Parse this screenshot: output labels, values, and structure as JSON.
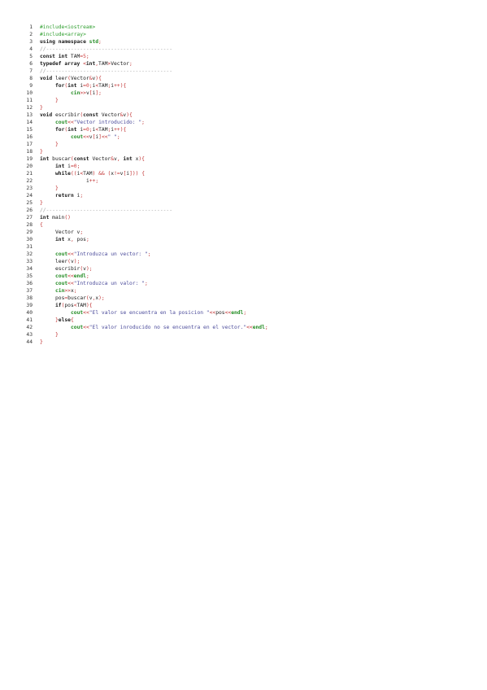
{
  "document": {
    "lines": [
      {
        "n": "1",
        "indent": 0,
        "segs": [
          [
            "pre",
            "#include<iostream>"
          ]
        ]
      },
      {
        "n": "2",
        "indent": 0,
        "segs": [
          [
            "pre",
            "#include<array>"
          ]
        ]
      },
      {
        "n": "3",
        "indent": 0,
        "segs": [
          [
            "kw",
            "using namespace "
          ],
          [
            "io",
            "std"
          ],
          [
            "op",
            ";"
          ]
        ]
      },
      {
        "n": "4",
        "indent": 0,
        "segs": [
          [
            "cm",
            "//-----------------------------------------"
          ]
        ]
      },
      {
        "n": "5",
        "indent": 0,
        "segs": [
          [
            "kw",
            "const int "
          ],
          [
            "id",
            "TAM"
          ],
          [
            "op",
            "="
          ],
          [
            "num",
            "5"
          ],
          [
            "op",
            ";"
          ]
        ]
      },
      {
        "n": "6",
        "indent": 0,
        "segs": [
          [
            "kw",
            "typedef array "
          ],
          [
            "op",
            "<"
          ],
          [
            "kw",
            "int"
          ],
          [
            "op",
            ","
          ],
          [
            "id",
            "TAM"
          ],
          [
            "op",
            ">"
          ],
          [
            "id",
            "Vector"
          ],
          [
            "op",
            ";"
          ]
        ]
      },
      {
        "n": "7",
        "indent": 0,
        "segs": [
          [
            "cm",
            "//-----------------------------------------"
          ]
        ]
      },
      {
        "n": "8",
        "indent": 0,
        "segs": [
          [
            "kw",
            "void "
          ],
          [
            "id",
            "leer"
          ],
          [
            "op",
            "("
          ],
          [
            "id",
            "Vector"
          ],
          [
            "op",
            "&"
          ],
          [
            "id",
            "v"
          ],
          [
            "op",
            ")"
          ],
          [
            "op",
            "{"
          ]
        ]
      },
      {
        "n": "9",
        "indent": 1,
        "segs": [
          [
            "kw",
            "for"
          ],
          [
            "op",
            "("
          ],
          [
            "kw",
            "int "
          ],
          [
            "id",
            "i"
          ],
          [
            "op",
            "="
          ],
          [
            "num",
            "0"
          ],
          [
            "op",
            ";"
          ],
          [
            "id",
            "i"
          ],
          [
            "op",
            "<"
          ],
          [
            "id",
            "TAM"
          ],
          [
            "op",
            ";"
          ],
          [
            "id",
            "i"
          ],
          [
            "op",
            "++"
          ],
          [
            "op",
            ")"
          ],
          [
            "op",
            "{"
          ]
        ]
      },
      {
        "n": "10",
        "indent": 2,
        "segs": [
          [
            "io",
            "cin"
          ],
          [
            "op",
            ">>"
          ],
          [
            "id",
            "v"
          ],
          [
            "op",
            "["
          ],
          [
            "id",
            "i"
          ],
          [
            "op",
            "]"
          ],
          [
            "op",
            ";"
          ]
        ]
      },
      {
        "n": "11",
        "indent": 1,
        "segs": [
          [
            "op",
            "}"
          ]
        ]
      },
      {
        "n": "12",
        "indent": 0,
        "segs": [
          [
            "op",
            "}"
          ]
        ]
      },
      {
        "n": "13",
        "indent": 0,
        "segs": [
          [
            "kw",
            "void "
          ],
          [
            "id",
            "escribir"
          ],
          [
            "op",
            "("
          ],
          [
            "kw",
            "const "
          ],
          [
            "id",
            "Vector"
          ],
          [
            "op",
            "&"
          ],
          [
            "id",
            "v"
          ],
          [
            "op",
            ")"
          ],
          [
            "op",
            "{"
          ]
        ]
      },
      {
        "n": "14",
        "indent": 1,
        "segs": [
          [
            "io",
            "cout"
          ],
          [
            "op",
            "<<"
          ],
          [
            "str",
            "\"Vector introducido: \""
          ],
          [
            "op",
            ";"
          ]
        ]
      },
      {
        "n": "15",
        "indent": 1,
        "segs": [
          [
            "kw",
            "for"
          ],
          [
            "op",
            "("
          ],
          [
            "kw",
            "int "
          ],
          [
            "id",
            "i"
          ],
          [
            "op",
            "="
          ],
          [
            "num",
            "0"
          ],
          [
            "op",
            ";"
          ],
          [
            "id",
            "i"
          ],
          [
            "op",
            "<"
          ],
          [
            "id",
            "TAM"
          ],
          [
            "op",
            ";"
          ],
          [
            "id",
            "i"
          ],
          [
            "op",
            "++"
          ],
          [
            "op",
            ")"
          ],
          [
            "op",
            "{"
          ]
        ]
      },
      {
        "n": "16",
        "indent": 2,
        "segs": [
          [
            "io",
            "cout"
          ],
          [
            "op",
            "<<"
          ],
          [
            "id",
            "v"
          ],
          [
            "op",
            "["
          ],
          [
            "id",
            "i"
          ],
          [
            "op",
            "]"
          ],
          [
            "op",
            "<<"
          ],
          [
            "str",
            "\" \""
          ],
          [
            "op",
            ";"
          ]
        ]
      },
      {
        "n": "17",
        "indent": 1,
        "segs": [
          [
            "op",
            "}"
          ]
        ]
      },
      {
        "n": "18",
        "indent": 0,
        "segs": [
          [
            "op",
            "}"
          ]
        ]
      },
      {
        "n": "19",
        "indent": 0,
        "segs": [
          [
            "kw",
            "int "
          ],
          [
            "id",
            "buscar"
          ],
          [
            "op",
            "("
          ],
          [
            "kw",
            "const "
          ],
          [
            "id",
            "Vector"
          ],
          [
            "op",
            "&"
          ],
          [
            "id",
            "v"
          ],
          [
            "op",
            ", "
          ],
          [
            "kw",
            "int "
          ],
          [
            "id",
            "x"
          ],
          [
            "op",
            ")"
          ],
          [
            "op",
            "{"
          ]
        ]
      },
      {
        "n": "20",
        "indent": 1,
        "segs": [
          [
            "kw",
            "int "
          ],
          [
            "id",
            "i"
          ],
          [
            "op",
            "="
          ],
          [
            "num",
            "0"
          ],
          [
            "op",
            ";"
          ]
        ]
      },
      {
        "n": "21",
        "indent": 1,
        "segs": [
          [
            "kw",
            "while"
          ],
          [
            "op",
            "(("
          ],
          [
            "id",
            "i"
          ],
          [
            "op",
            "<"
          ],
          [
            "id",
            "TAM"
          ],
          [
            "op",
            ") && ("
          ],
          [
            "id",
            "x"
          ],
          [
            "op",
            "!="
          ],
          [
            "id",
            "v"
          ],
          [
            "op",
            "["
          ],
          [
            "id",
            "i"
          ],
          [
            "op",
            "])) {"
          ]
        ]
      },
      {
        "n": "22",
        "indent": 3,
        "segs": [
          [
            "id",
            "i"
          ],
          [
            "op",
            "++;"
          ]
        ]
      },
      {
        "n": "23",
        "indent": 1,
        "segs": [
          [
            "op",
            "}"
          ]
        ]
      },
      {
        "n": "24",
        "indent": 1,
        "segs": [
          [
            "kw",
            "return "
          ],
          [
            "id",
            "i"
          ],
          [
            "op",
            ";"
          ]
        ]
      },
      {
        "n": "25",
        "indent": 0,
        "segs": [
          [
            "op",
            "}"
          ]
        ]
      },
      {
        "n": "26",
        "indent": 0,
        "segs": [
          [
            "cm",
            "//-----------------------------------------"
          ]
        ]
      },
      {
        "n": "27",
        "indent": 0,
        "segs": [
          [
            "kw",
            "int "
          ],
          [
            "id",
            "main"
          ],
          [
            "op",
            "()"
          ]
        ]
      },
      {
        "n": "28",
        "indent": 0,
        "segs": [
          [
            "op",
            "{"
          ]
        ]
      },
      {
        "n": "29",
        "indent": 1,
        "segs": [
          [
            "id",
            "Vector v"
          ],
          [
            "op",
            ";"
          ]
        ]
      },
      {
        "n": "30",
        "indent": 1,
        "segs": [
          [
            "kw",
            "int "
          ],
          [
            "id",
            "x"
          ],
          [
            "op",
            ", "
          ],
          [
            "id",
            "pos"
          ],
          [
            "op",
            ";"
          ]
        ]
      },
      {
        "n": "31",
        "indent": 0,
        "segs": []
      },
      {
        "n": "32",
        "indent": 1,
        "segs": [
          [
            "io",
            "cout"
          ],
          [
            "op",
            "<<"
          ],
          [
            "str",
            "\"Introduzca un vector: \""
          ],
          [
            "op",
            ";"
          ]
        ]
      },
      {
        "n": "33",
        "indent": 1,
        "segs": [
          [
            "id",
            "leer"
          ],
          [
            "op",
            "("
          ],
          [
            "id",
            "v"
          ],
          [
            "op",
            ");"
          ]
        ]
      },
      {
        "n": "34",
        "indent": 1,
        "segs": [
          [
            "id",
            "escribir"
          ],
          [
            "op",
            "("
          ],
          [
            "id",
            "v"
          ],
          [
            "op",
            ");"
          ]
        ]
      },
      {
        "n": "35",
        "indent": 1,
        "segs": [
          [
            "io",
            "cout"
          ],
          [
            "op",
            "<<"
          ],
          [
            "io",
            "endl"
          ],
          [
            "op",
            ";"
          ]
        ]
      },
      {
        "n": "36",
        "indent": 1,
        "segs": [
          [
            "io",
            "cout"
          ],
          [
            "op",
            "<<"
          ],
          [
            "str",
            "\"Introduzca un valor: \""
          ],
          [
            "op",
            ";"
          ]
        ]
      },
      {
        "n": "37",
        "indent": 1,
        "segs": [
          [
            "io",
            "cin"
          ],
          [
            "op",
            ">>"
          ],
          [
            "id",
            "x"
          ],
          [
            "op",
            ";"
          ]
        ]
      },
      {
        "n": "38",
        "indent": 1,
        "segs": [
          [
            "id",
            "pos"
          ],
          [
            "op",
            "="
          ],
          [
            "id",
            "buscar"
          ],
          [
            "op",
            "("
          ],
          [
            "id",
            "v"
          ],
          [
            "op",
            ","
          ],
          [
            "id",
            "x"
          ],
          [
            "op",
            ");"
          ]
        ]
      },
      {
        "n": "39",
        "indent": 1,
        "segs": [
          [
            "kw",
            "if"
          ],
          [
            "op",
            "("
          ],
          [
            "id",
            "pos"
          ],
          [
            "op",
            "<"
          ],
          [
            "id",
            "TAM"
          ],
          [
            "op",
            ")"
          ],
          [
            "op",
            "{"
          ]
        ]
      },
      {
        "n": "40",
        "indent": 2,
        "segs": [
          [
            "io",
            "cout"
          ],
          [
            "op",
            "<<"
          ],
          [
            "str",
            "\"El valor se encuentra en la posicion \""
          ],
          [
            "op",
            "<<"
          ],
          [
            "id",
            "pos"
          ],
          [
            "op",
            "<<"
          ],
          [
            "io",
            "endl"
          ],
          [
            "op",
            ";"
          ]
        ]
      },
      {
        "n": "41",
        "indent": 1,
        "segs": [
          [
            "op",
            "}"
          ],
          [
            "kw",
            "else"
          ],
          [
            "op",
            "{"
          ]
        ]
      },
      {
        "n": "42",
        "indent": 2,
        "segs": [
          [
            "io",
            "cout"
          ],
          [
            "op",
            "<<"
          ],
          [
            "str",
            "\"El valor inroducido no se encuentra en el vector.\""
          ],
          [
            "op",
            "<<"
          ],
          [
            "io",
            "endl"
          ],
          [
            "op",
            ";"
          ]
        ]
      },
      {
        "n": "43",
        "indent": 1,
        "segs": [
          [
            "op",
            "}"
          ]
        ]
      },
      {
        "n": "44",
        "indent": 0,
        "segs": [
          [
            "op",
            "}"
          ]
        ]
      }
    ]
  }
}
